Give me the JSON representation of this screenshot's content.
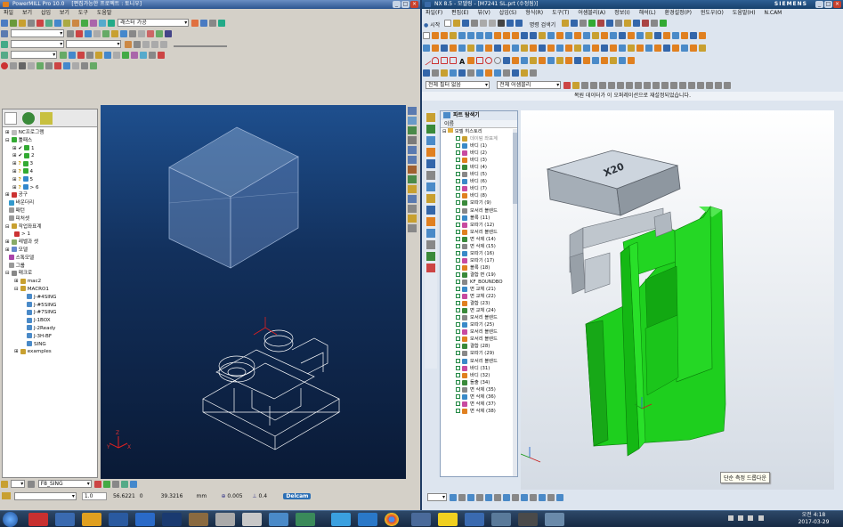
{
  "pm": {
    "title": "PowerMILL Pro 10.0",
    "project": "[편집가능한 프로젝트 : 토니우]",
    "menu": [
      "파일",
      "보기",
      "삽입",
      "보기",
      "도구",
      "도움말"
    ],
    "toolbar_combo_1": "",
    "strategy_label": "래스터 가공",
    "tool_combo": "F8_SING",
    "status": {
      "v1": "1.0",
      "x": "56.6221",
      "y": "0",
      "z": "39.3216",
      "unit": "mm",
      "tol": "0.005",
      "step": "0.4",
      "brand": "Delcam"
    },
    "tree": {
      "root": "NC프로그램",
      "toolpaths": "툴패스",
      "tp_items": [
        "1",
        "2",
        "3",
        "4",
        "5",
        "> 6"
      ],
      "items": [
        "공구",
        "바운더리",
        "패턴",
        "피처셋",
        "작업좌표계",
        "> 1",
        "레벨과 셋",
        "모델",
        "스톡모델",
        "그룹",
        "매크로",
        "mac2",
        "MACRO1",
        "J-#4SING",
        "J-#5SING",
        "J-#7SING",
        "J-1BOX",
        "J-2Ready",
        "J-3H-BF",
        "SING",
        "examples"
      ]
    }
  },
  "nx": {
    "title": "NX 8.5 - 모델링 - [M7241 SL.prt (수정됨)]",
    "brand": "SIEMENS",
    "menu": [
      "파일(F)",
      "편집(E)",
      "뷰(V)",
      "삽입(S)",
      "형식(R)",
      "도구(T)",
      "어셈블리(A)",
      "정보(I)",
      "해석(L)",
      "환경설정(P)",
      "윈도우(O)",
      "도움말(H)",
      "N.CAM"
    ],
    "start_label": "시작",
    "find_label": "명령 검색기",
    "filter_combo": "전체 필터 없음",
    "asm_combo": "전체 어셈블리",
    "status_msg": "복원 데이터가 이 오퍼레이션으로 재설정되었습니다.",
    "navigator": {
      "title": "파트 탐색기",
      "col": "이름",
      "root": "모델 히스토리",
      "datum": "데이텀 좌표계",
      "items": [
        "바디 (1)",
        "바디 (2)",
        "바디 (3)",
        "바디 (4)",
        "바디 (5)",
        "바디 (6)",
        "바디 (7)",
        "바디 (8)",
        "모따기 (9)",
        "모서리 블렌드",
        "블록 (11)",
        "모따기 (12)",
        "모서리 블렌드",
        "면 삭제 (14)",
        "면 삭제 (15)",
        "모따기 (16)",
        "모따기 (17)",
        "블록 (18)",
        "결합 면 (19)",
        "KF_BOUNDBO",
        "면 교체 (21)",
        "면 교체 (22)",
        "결합 (23)",
        "면 교체 (24)",
        "모서리 블렌드",
        "모따기 (25)",
        "모서리 블렌드",
        "모서리 블렌드",
        "결합 (28)",
        "모따기 (29)",
        "모서리 블렌드",
        "바디 (31)",
        "바디 (32)",
        "돌출 (34)",
        "면 삭제 (35)",
        "면 삭제 (36)",
        "면 삭제 (37)",
        "면 삭제 (38)"
      ]
    },
    "tooltip": "단순 측정 드롭다운",
    "engrave": "X20"
  },
  "taskbar": {
    "time": "오전 4:18",
    "date": "2017-03-29"
  }
}
